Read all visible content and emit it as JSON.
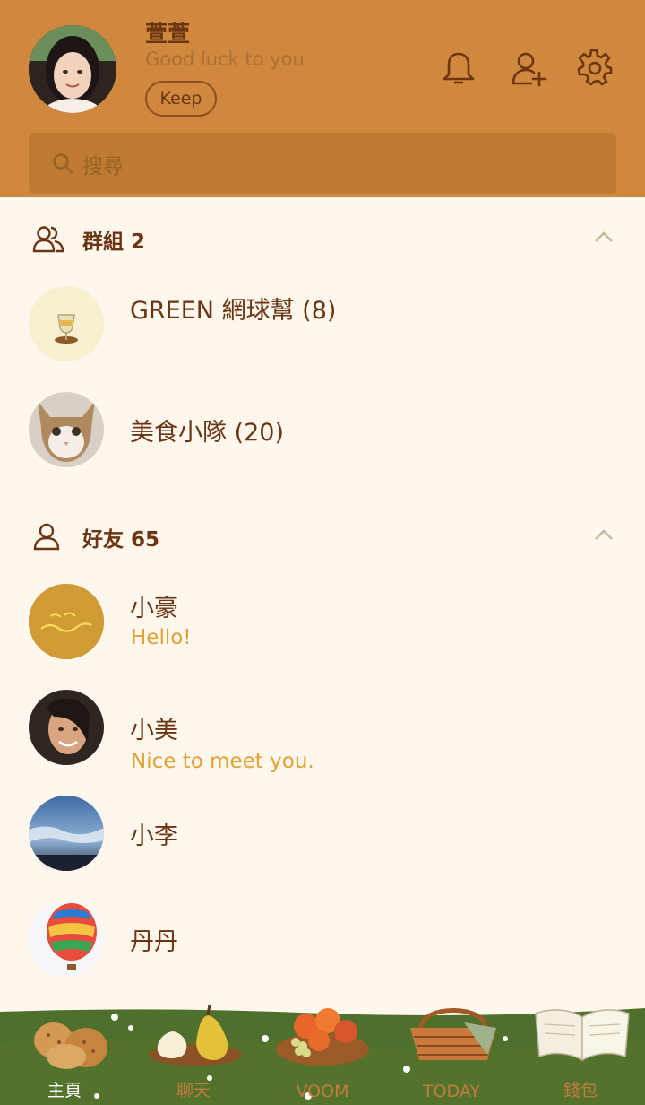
{
  "profile": {
    "name": "萱萱",
    "status": "Good luck to you",
    "keep_label": "Keep"
  },
  "header_icons": [
    "bell-icon",
    "add-friend-icon",
    "gear-icon"
  ],
  "search": {
    "placeholder": "搜尋"
  },
  "groups": {
    "title": "群組 2",
    "items": [
      {
        "name": "GREEN 網球幫 (8)"
      },
      {
        "name": "美食小隊 (20)"
      }
    ]
  },
  "friends": {
    "title": "好友 65",
    "items": [
      {
        "name": "小豪",
        "status": "Hello!"
      },
      {
        "name": "小美",
        "status": "Nice to meet you."
      },
      {
        "name": "小李",
        "status": ""
      },
      {
        "name": "丹丹",
        "status": ""
      }
    ]
  },
  "nav": {
    "items": [
      {
        "label": "主頁"
      },
      {
        "label": "聊天"
      },
      {
        "label": "VOOM"
      },
      {
        "label": "TODAY"
      },
      {
        "label": "錢包"
      }
    ]
  },
  "colors": {
    "header_bg": "#cf883d",
    "page_bg": "#fdf7ee",
    "accent_text": "#6b3511",
    "status_text": "#e3a133",
    "grass": "#4f6f2c"
  }
}
